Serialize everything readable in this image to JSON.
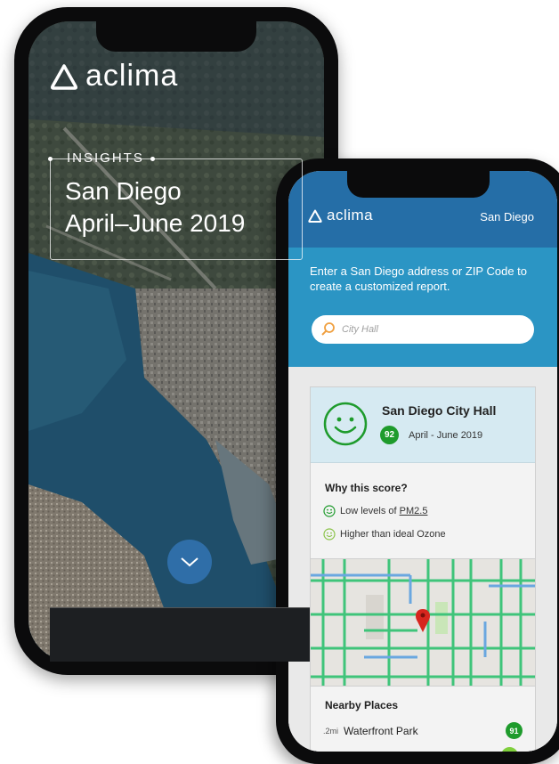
{
  "back_phone": {
    "brand": "aclima",
    "insights_label": "INSIGHTS",
    "hero_line1": "San Diego",
    "hero_line2": "April–June 2019",
    "scroll_icon": "chevron-down-icon"
  },
  "front_phone": {
    "brand": "aclima",
    "city": "San Diego",
    "prompt": "Enter a San Diego address or ZIP Code to create a customized report.",
    "search_placeholder": "City Hall",
    "card": {
      "place": "San Diego City Hall",
      "score": "92",
      "date_range": "April - June 2019",
      "why_title": "Why this score?",
      "reason1_prefix": "Low levels of ",
      "reason1_link": "PM2.5",
      "reason2": "Higher than ideal Ozone",
      "nearby_title": "Nearby Places",
      "nearby": [
        {
          "distance": ".2mi",
          "name": "Waterfront Park",
          "score": "91"
        }
      ]
    }
  },
  "colors": {
    "header_blue": "#256ea7",
    "search_blue": "#2b95c4",
    "good_green": "#1e9b2c"
  }
}
